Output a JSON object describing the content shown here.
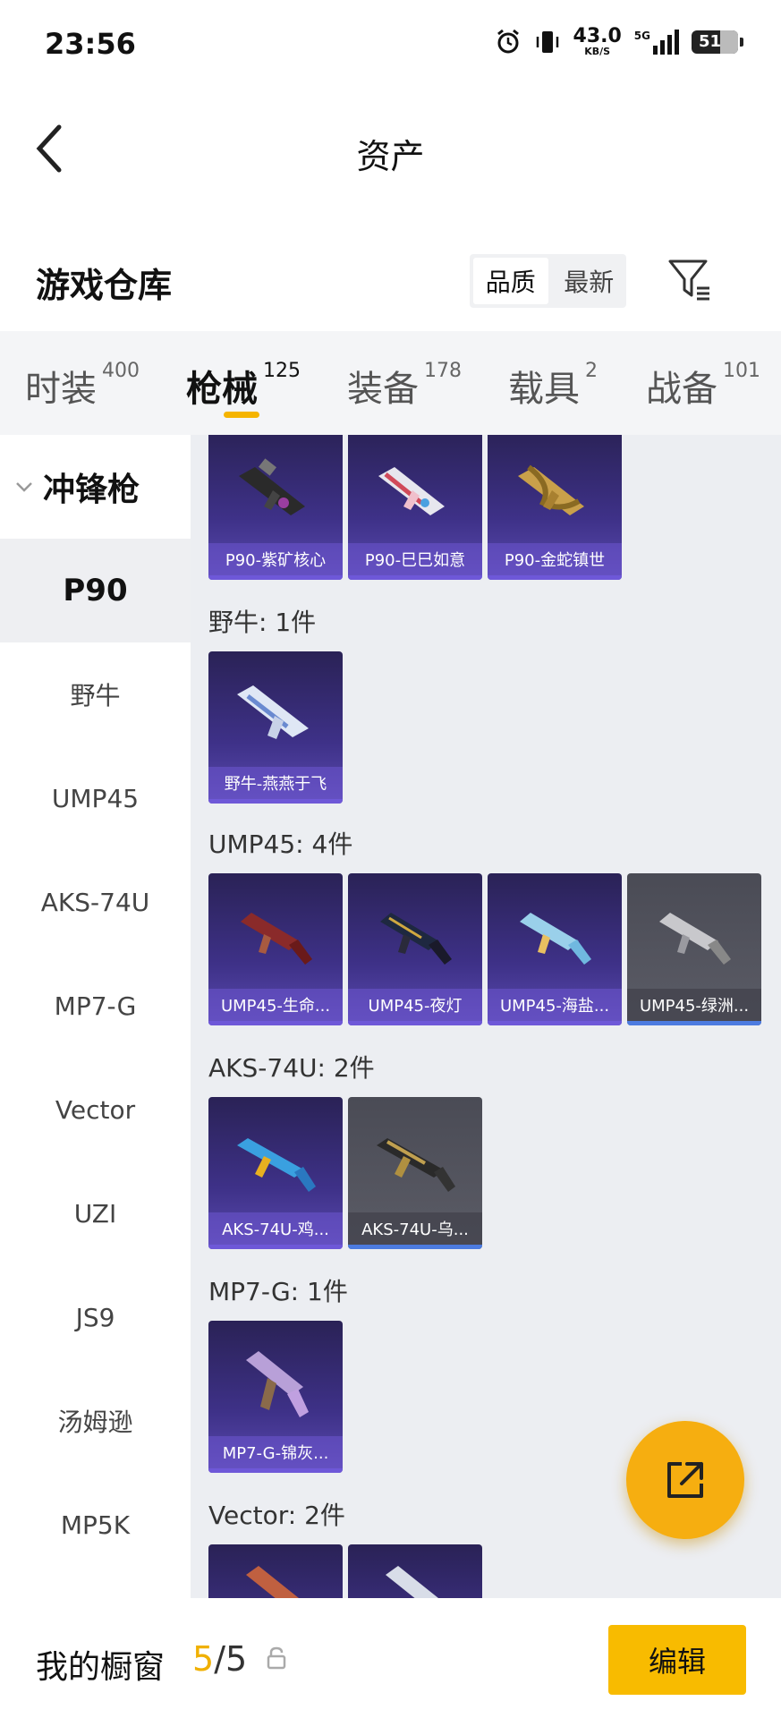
{
  "status_bar": {
    "time": "23:56",
    "net_speed_value": "43.0",
    "net_speed_unit": "KB/S",
    "network_label": "5G",
    "battery_level": "51"
  },
  "top_bar": {
    "title": "资产",
    "back_icon": "chevron-left-icon"
  },
  "header": {
    "title": "游戏仓库",
    "sort_options": [
      "品质",
      "最新"
    ],
    "sort_selected": "品质",
    "filter_icon": "filter-icon"
  },
  "tabs": [
    {
      "label": "时装",
      "count": "400"
    },
    {
      "label": "枪械",
      "count": "125"
    },
    {
      "label": "装备",
      "count": "178"
    },
    {
      "label": "载具",
      "count": "2"
    },
    {
      "label": "战备",
      "count": "101"
    }
  ],
  "active_tab": "枪械",
  "sidebar": {
    "group_label": "冲锋枪",
    "items": [
      "P90",
      "野牛",
      "UMP45",
      "AKS-74U",
      "MP7-G",
      "Vector",
      "UZI",
      "JS9",
      "汤姆逊",
      "MP5K"
    ],
    "selected": "P90"
  },
  "sections": [
    {
      "label": "",
      "items": [
        {
          "name": "P90-紫矿核心",
          "rarity": "purple"
        },
        {
          "name": "P90-巳巳如意",
          "rarity": "purple"
        },
        {
          "name": "P90-金蛇镇世",
          "rarity": "purple"
        }
      ]
    },
    {
      "label": "野牛: 1件",
      "items": [
        {
          "name": "野牛-燕燕于飞",
          "rarity": "purple"
        }
      ]
    },
    {
      "label": "UMP45: 4件",
      "items": [
        {
          "name": "UMP45-生命...",
          "rarity": "purple"
        },
        {
          "name": "UMP45-夜灯",
          "rarity": "purple"
        },
        {
          "name": "UMP45-海盐...",
          "rarity": "purple"
        },
        {
          "name": "UMP45-绿洲...",
          "rarity": "grey"
        }
      ]
    },
    {
      "label": "AKS-74U: 2件",
      "items": [
        {
          "name": "AKS-74U-鸡...",
          "rarity": "purple"
        },
        {
          "name": "AKS-74U-乌...",
          "rarity": "grey"
        }
      ]
    },
    {
      "label": "MP7-G: 1件",
      "items": [
        {
          "name": "MP7-G-锦灰...",
          "rarity": "purple"
        }
      ]
    },
    {
      "label": "Vector: 2件",
      "items": [
        {
          "name": "",
          "rarity": "purple"
        },
        {
          "name": "",
          "rarity": "purple"
        }
      ]
    }
  ],
  "fab_icon": "share-external-icon",
  "bottom_bar": {
    "title": "我的橱窗",
    "current": "5",
    "separator": "/",
    "total": "5",
    "lock_icon": "lock-icon",
    "edit_label": "编辑"
  },
  "colors": {
    "accent": "#f5b400",
    "card_purple": "#3e3188",
    "card_grey": "#5b5c66",
    "content_bg": "#eceef2"
  }
}
